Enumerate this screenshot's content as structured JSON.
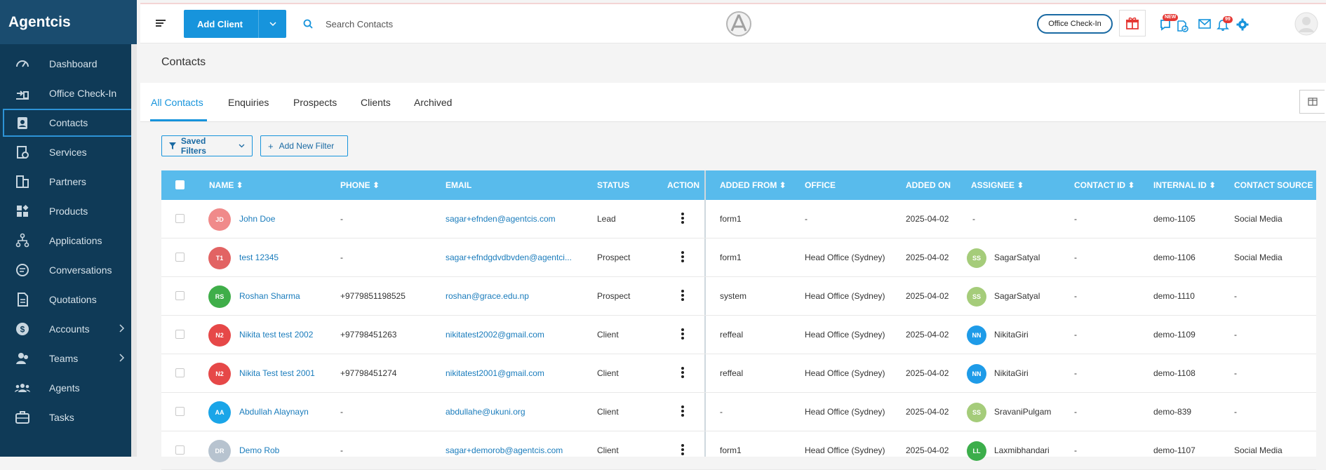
{
  "app": {
    "brand": "Agentcis"
  },
  "sidebar": {
    "items": [
      {
        "label": "Dashboard",
        "icon": "dashboard-icon"
      },
      {
        "label": "Office Check-In",
        "icon": "office-checkin-icon"
      },
      {
        "label": "Contacts",
        "icon": "contacts-icon",
        "active": true
      },
      {
        "label": "Services",
        "icon": "services-icon"
      },
      {
        "label": "Partners",
        "icon": "partners-icon"
      },
      {
        "label": "Products",
        "icon": "products-icon"
      },
      {
        "label": "Applications",
        "icon": "applications-icon"
      },
      {
        "label": "Conversations",
        "icon": "conversations-icon"
      },
      {
        "label": "Quotations",
        "icon": "quotations-icon"
      },
      {
        "label": "Accounts",
        "icon": "accounts-icon",
        "chevron": true
      },
      {
        "label": "Teams",
        "icon": "teams-icon",
        "chevron": true
      },
      {
        "label": "Agents",
        "icon": "agents-icon"
      },
      {
        "label": "Tasks",
        "icon": "tasks-icon"
      }
    ]
  },
  "topbar": {
    "add_client_label": "Add Client",
    "search_placeholder": "Search Contacts",
    "office_checkin_label": "Office Check-In",
    "new_badge": "NEW",
    "notif_badge": "99"
  },
  "page": {
    "title": "Contacts"
  },
  "tabs": [
    "All Contacts",
    "Enquiries",
    "Prospects",
    "Clients",
    "Archived"
  ],
  "filters": {
    "saved_label": "Saved Filters",
    "add_label": "Add New Filter"
  },
  "table": {
    "headers": {
      "name": "NAME",
      "phone": "PHONE",
      "email": "EMAIL",
      "status": "STATUS",
      "action": "ACTION",
      "added_from": "ADDED FROM",
      "office": "OFFICE",
      "added_on": "ADDED ON",
      "assignee": "ASSIGNEE",
      "contact_id": "CONTACT ID",
      "internal_id": "INTERNAL ID",
      "contact_source": "CONTACT SOURCE"
    },
    "rows": [
      {
        "initials": "JD",
        "avatar_color": "#f08a8a",
        "name": "John Doe",
        "phone": "-",
        "email": "sagar+efnden@agentcis.com",
        "status": "Lead",
        "added_from": "form1",
        "office": "-",
        "added_on": "2025-04-02",
        "assignee_initials": "",
        "assignee_color": "",
        "assignee": "-",
        "contact_id": "-",
        "internal_id": "demo-1105",
        "source": "Social Media"
      },
      {
        "initials": "T1",
        "avatar_color": "#e26363",
        "name": "test 12345",
        "phone": "-",
        "email": "sagar+efndgdvdbvden@agentci...",
        "status": "Prospect",
        "added_from": "form1",
        "office": "Head Office (Sydney)",
        "added_on": "2025-04-02",
        "assignee_initials": "SS",
        "assignee_color": "#a5cc7a",
        "assignee": "SagarSatyal",
        "contact_id": "-",
        "internal_id": "demo-1106",
        "source": "Social Media"
      },
      {
        "initials": "RS",
        "avatar_color": "#3fae49",
        "name": "Roshan Sharma",
        "phone": "+9779851198525",
        "email": "roshan@grace.edu.np",
        "status": "Prospect",
        "added_from": "system",
        "office": "Head Office (Sydney)",
        "added_on": "2025-04-02",
        "assignee_initials": "SS",
        "assignee_color": "#a5cc7a",
        "assignee": "SagarSatyal",
        "contact_id": "-",
        "internal_id": "demo-1110",
        "source": "-"
      },
      {
        "initials": "N2",
        "avatar_color": "#e64848",
        "name": "Nikita test test 2002",
        "phone": "+97798451263",
        "email": "nikitatest2002@gmail.com",
        "status": "Client",
        "added_from": "reffeal",
        "office": "Head Office (Sydney)",
        "added_on": "2025-04-02",
        "assignee_initials": "NN",
        "assignee_color": "#1e9be8",
        "assignee": "NikitaGiri",
        "contact_id": "-",
        "internal_id": "demo-1109",
        "source": "-"
      },
      {
        "initials": "N2",
        "avatar_color": "#e64848",
        "name": "Nikita Test test 2001",
        "phone": "+97798451274",
        "email": "nikitatest2001@gmail.com",
        "status": "Client",
        "added_from": "reffeal",
        "office": "Head Office (Sydney)",
        "added_on": "2025-04-02",
        "assignee_initials": "NN",
        "assignee_color": "#1e9be8",
        "assignee": "NikitaGiri",
        "contact_id": "-",
        "internal_id": "demo-1108",
        "source": "-"
      },
      {
        "initials": "AA",
        "avatar_color": "#1aa5e8",
        "name": "Abdullah Alaynayn",
        "phone": "-",
        "email": "abdullahe@ukuni.org",
        "status": "Client",
        "added_from": "-",
        "office": "Head Office (Sydney)",
        "added_on": "2025-04-02",
        "assignee_initials": "SS",
        "assignee_color": "#a5cc7a",
        "assignee": "SravaniPulgam",
        "contact_id": "-",
        "internal_id": "demo-839",
        "source": "-"
      },
      {
        "initials": "DR",
        "avatar_color": "#b7c3cf",
        "name": "Demo Rob",
        "phone": "-",
        "email": "sagar+demorob@agentcis.com",
        "status": "Client",
        "added_from": "form1",
        "office": "Head Office (Sydney)",
        "added_on": "2025-04-02",
        "assignee_initials": "LL",
        "assignee_color": "#3cae4b",
        "assignee": "Laxmibhandari",
        "contact_id": "-",
        "internal_id": "demo-1107",
        "source": "Social Media"
      }
    ]
  },
  "colors": {
    "sidebar": "#0f3a57",
    "accent": "#1794dc",
    "table_header": "#58bbec"
  }
}
